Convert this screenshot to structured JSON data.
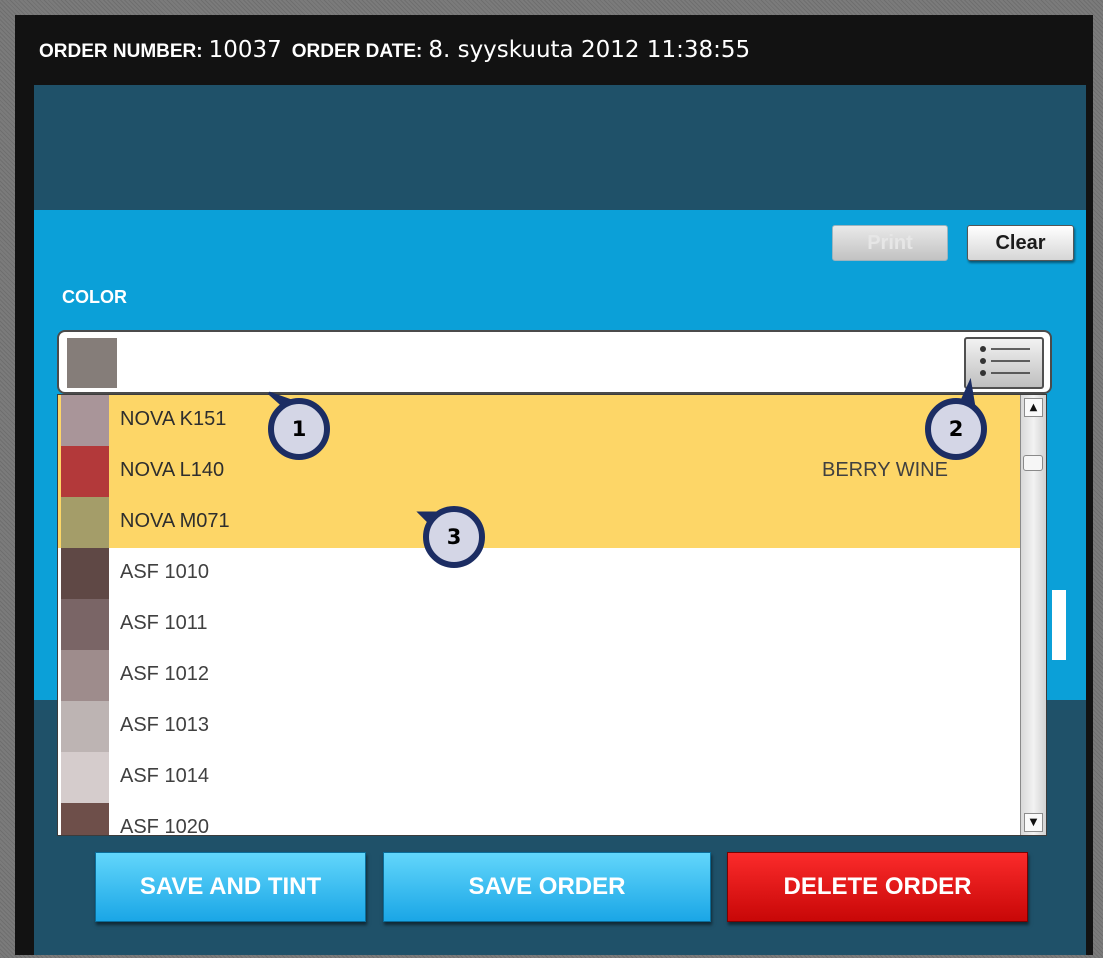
{
  "header": {
    "order_number_label": "ORDER NUMBER:",
    "order_number": "10037",
    "order_date_label": "ORDER DATE:",
    "order_date": "8. syyskuuta 2012 11:38:55"
  },
  "toolbar": {
    "print_label": "Print",
    "clear_label": "Clear"
  },
  "color_field": {
    "label": "COLOR",
    "value": "",
    "swatch_color": "#857d79"
  },
  "dropdown": {
    "rows": [
      {
        "code": "NOVA K151",
        "name": "",
        "swatch": "#a99599",
        "selected": true
      },
      {
        "code": "NOVA L140",
        "name": "BERRY WINE",
        "swatch": "#b3393a",
        "selected": true
      },
      {
        "code": "NOVA M071",
        "name": "",
        "swatch": "#a49d69",
        "selected": true
      },
      {
        "code": "ASF 1010",
        "name": "",
        "swatch": "#5f4845",
        "selected": false
      },
      {
        "code": "ASF 1011",
        "name": "",
        "swatch": "#7a6566",
        "selected": false
      },
      {
        "code": "ASF 1012",
        "name": "",
        "swatch": "#9e8c8c",
        "selected": false
      },
      {
        "code": "ASF 1013",
        "name": "",
        "swatch": "#bdb4b3",
        "selected": false
      },
      {
        "code": "ASF 1014",
        "name": "",
        "swatch": "#d5cccc",
        "selected": false
      },
      {
        "code": "ASF 1020",
        "name": "",
        "swatch": "#6e4f4a",
        "selected": false
      }
    ]
  },
  "actions": {
    "save_and_tint": "SAVE AND TINT",
    "save_order": "SAVE ORDER",
    "delete_order": "DELETE ORDER"
  },
  "callouts": [
    {
      "number": "1"
    },
    {
      "number": "2"
    },
    {
      "number": "3"
    }
  ],
  "colors": {
    "panel_blue": "#0ba0d8",
    "dark_band": "#1f5169",
    "selection_yellow": "#fdd667",
    "action_blue": "#1aa6e6",
    "delete_red": "#e01010"
  }
}
